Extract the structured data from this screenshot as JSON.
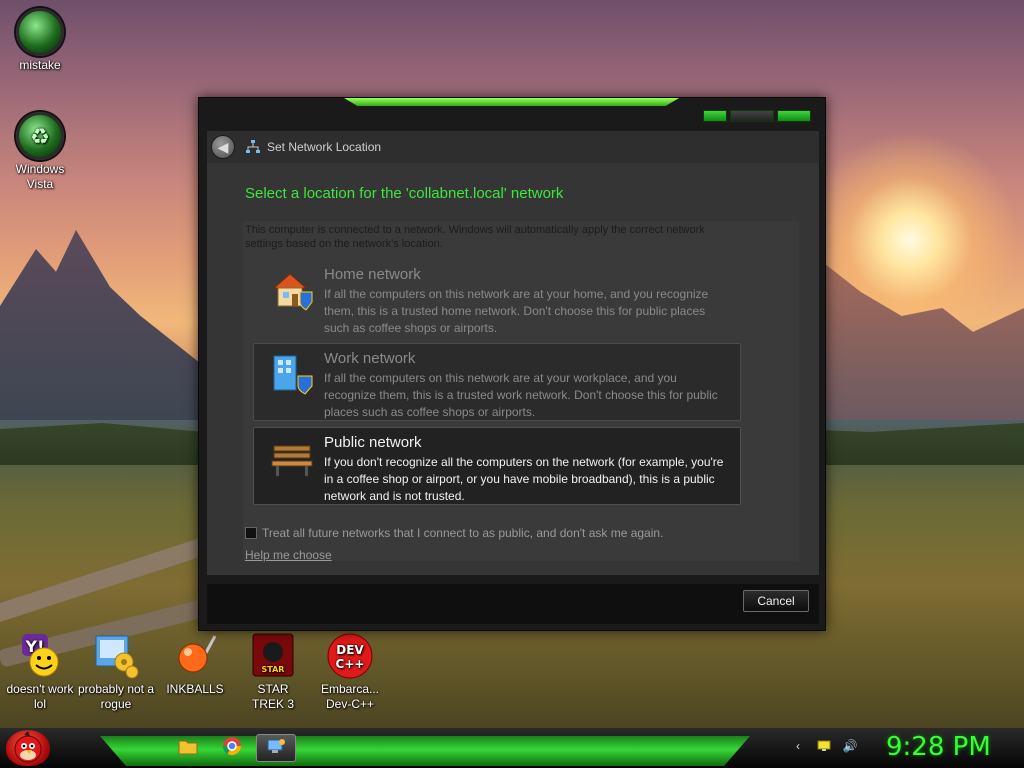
{
  "desktop": {
    "icons": [
      {
        "label": "mistake",
        "icon": "green-orb-icon"
      },
      {
        "label": "Windows Vista",
        "icon": "recycle-bin-icon"
      },
      {
        "label": "doesn't work lol",
        "icon": "yahoo-messenger-icon"
      },
      {
        "label": "probably not a rogue",
        "icon": "control-panel-icon"
      },
      {
        "label": "INKBALLS",
        "icon": "inkball-icon"
      },
      {
        "label": "STAR TREK 3",
        "icon": "star-trek-icon"
      },
      {
        "label": "Embarca... Dev-C++",
        "icon": "dev-cpp-icon"
      }
    ]
  },
  "window": {
    "title": "Set Network Location",
    "heading": "Select a location for the 'collabnet.local' network",
    "intro": "This computer is connected to a network. Windows will automatically apply the correct network settings based on the network's location.",
    "options": [
      {
        "title": "Home network",
        "desc": "If all the computers on this network are at your home, and you recognize them, this is a trusted home network.  Don't choose this for public places such as coffee shops or airports.",
        "icon": "house-icon"
      },
      {
        "title": "Work network",
        "desc": "If all the computers on this network are at your workplace, and you recognize them, this is a trusted work network.  Don't choose this for public places such as coffee shops or airports.",
        "icon": "office-building-icon"
      },
      {
        "title": "Public network",
        "desc": "If you don't recognize all the computers on the network (for example, you're in a coffee shop or airport, or you have mobile broadband), this is a public network and is not trusted.",
        "icon": "park-bench-icon"
      }
    ],
    "checkbox_label": "Treat all future networks that I connect to as public, and don't ask me again.",
    "checkbox_checked": false,
    "help_link": "Help me choose",
    "cancel_label": "Cancel",
    "accent_color": "#3ee63e"
  },
  "taskbar": {
    "pinned": [
      "folder-icon",
      "chrome-icon",
      "network-wizard-icon"
    ],
    "tray": [
      "chevron-left-icon",
      "network-icon",
      "volume-icon"
    ],
    "clock": "9:28 PM"
  }
}
